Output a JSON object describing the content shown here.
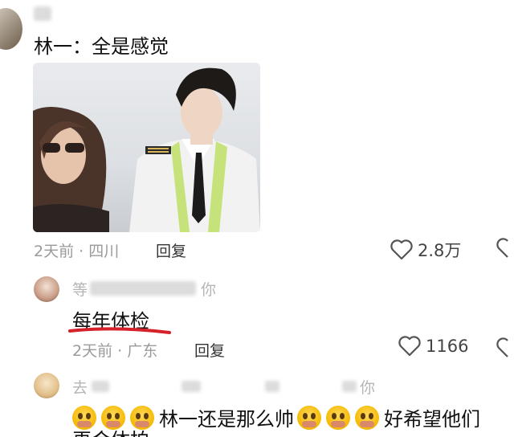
{
  "comment1": {
    "username_partial": "",
    "text": "林一：全是感觉",
    "meta": "2天前 · 四川",
    "reply_label": "回复",
    "likes": "2.8万"
  },
  "comment2": {
    "username_start": "等",
    "username_end": "你",
    "text": "每年体检",
    "meta": "2天前 · 广东",
    "reply_label": "回复",
    "likes": "1166"
  },
  "comment3": {
    "username_start": "去",
    "username_end": "你",
    "text_mid": "林一还是那么帅",
    "text_end": "好希望他们",
    "text_line2": "再合体拍"
  },
  "icons": {
    "heart": "heart-icon",
    "crying": "pleading-face-emoji"
  },
  "colors": {
    "underline": "#d4212a",
    "meta": "#9a9a9a"
  }
}
